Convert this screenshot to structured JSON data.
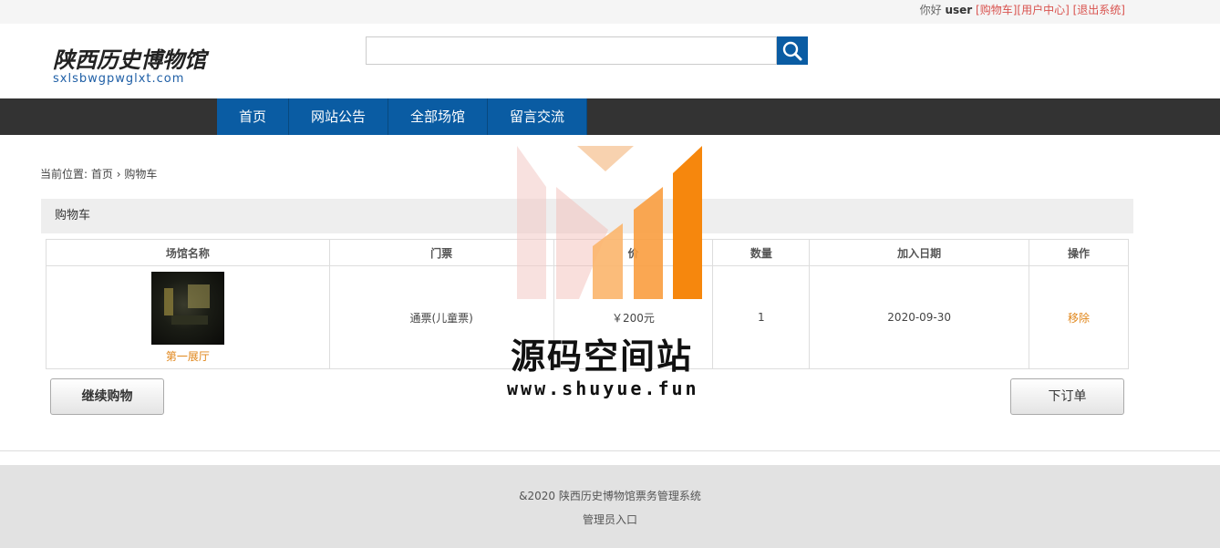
{
  "topbar": {
    "greeting": "你好",
    "username": "user",
    "cart_link": "[购物车]",
    "user_center_link": "[用户中心]",
    "logout_link": "[退出系统]"
  },
  "logo": {
    "cn": "陕西历史博物馆",
    "en": "sxlsbwgpwglxt.com"
  },
  "search": {
    "value": "",
    "placeholder": "",
    "icon": "search-icon"
  },
  "nav": {
    "items": [
      "首页",
      "网站公告",
      "全部场馆",
      "留言交流"
    ]
  },
  "breadcrumb": {
    "prefix": "当前位置:",
    "home": "首页",
    "separator": "›",
    "current": "购物车"
  },
  "panel": {
    "title": "购物车"
  },
  "table": {
    "headers": [
      "场馆名称",
      "门票",
      "价",
      "数量",
      "加入日期",
      "操作"
    ],
    "rows": [
      {
        "hall_name": "第一展厅",
        "ticket": "通票(儿童票)",
        "price": "￥200元",
        "quantity": "1",
        "date": "2020-09-30",
        "action": "移除"
      }
    ]
  },
  "buttons": {
    "continue": "继续购物",
    "order": "下订单"
  },
  "footer": {
    "copyright": "&2020 陕西历史博物馆票务管理系统",
    "admin_link": "管理员入口"
  },
  "watermark": {
    "title": "源码空间站",
    "url": "www.shuyue.fun"
  },
  "colors": {
    "brand_blue": "#0a5ca3",
    "nav_bg": "#333333",
    "link_red": "#d9534f",
    "accent_orange": "#e0861a"
  }
}
